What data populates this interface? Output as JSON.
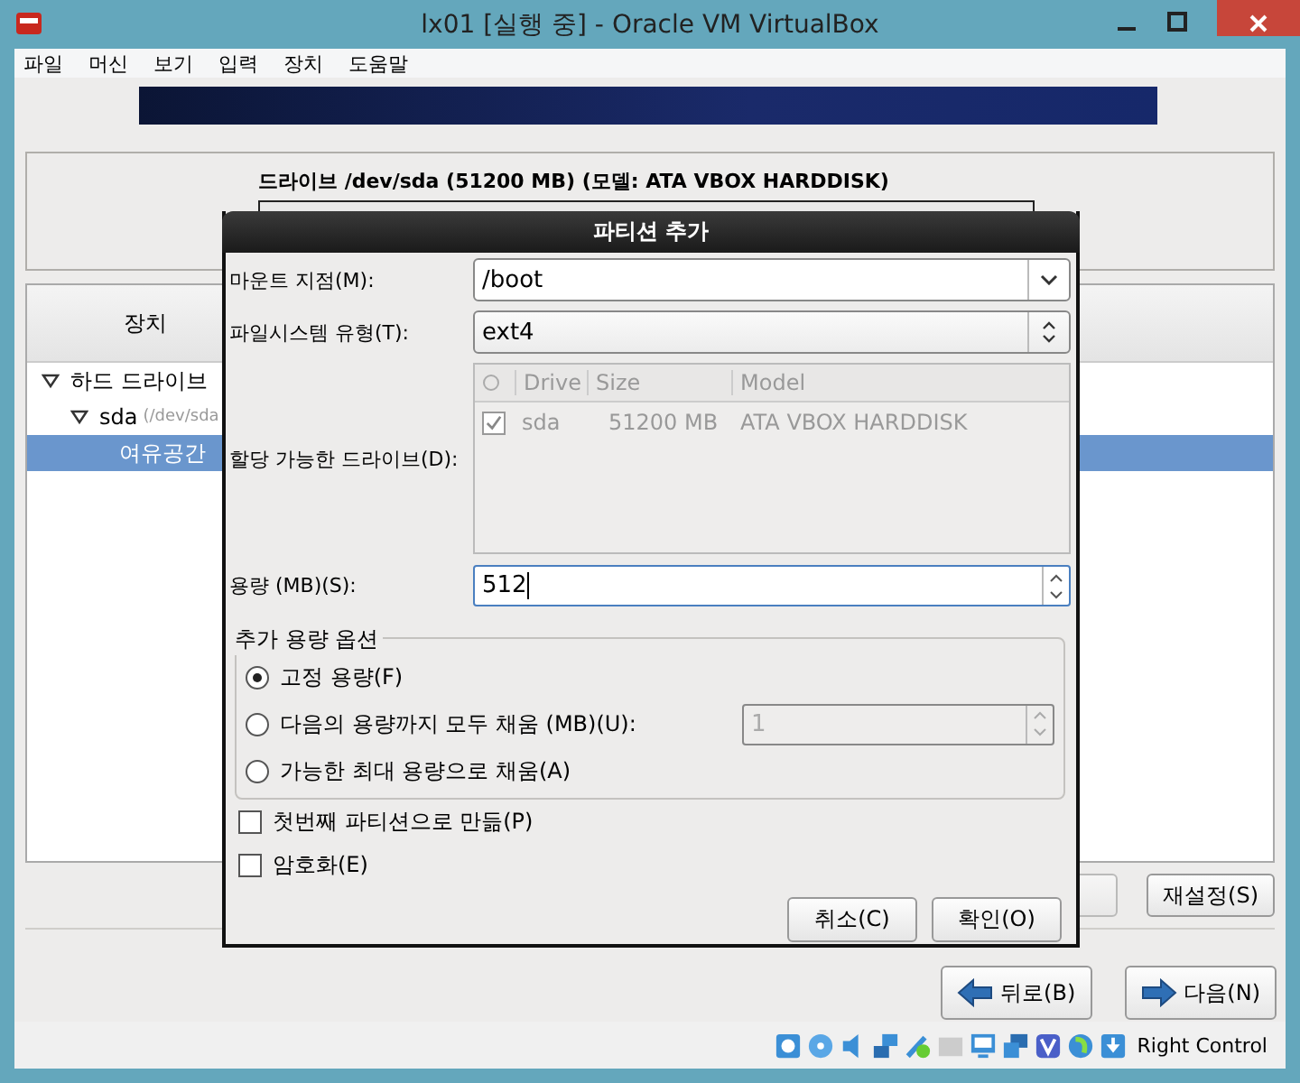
{
  "window": {
    "title": "lx01 [실행 중] - Oracle VM VirtualBox"
  },
  "menu": [
    "파일",
    "머신",
    "보기",
    "입력",
    "장치",
    "도움말"
  ],
  "drive_panel": {
    "heading": "드라이브 /dev/sda (51200 MB) (모델: ATA VBOX HARDDISK)"
  },
  "device_tree": {
    "column": "장치",
    "items": [
      {
        "label": "하드 드라이브",
        "expanded": true,
        "children": [
          {
            "label": "sda",
            "detail": "(/dev/sda",
            "expanded": true,
            "children": [
              {
                "label": "여유공간",
                "selected": true
              }
            ]
          }
        ]
      }
    ]
  },
  "reset_button": "재설정(S)",
  "nav_buttons": [
    {
      "label": "뒤로(B)",
      "kind": "back"
    },
    {
      "label": "다음(N)",
      "kind": "next"
    }
  ],
  "status_bar": {
    "host_key": "Right Control"
  },
  "dialog": {
    "title": "파티션 추가",
    "mount_point": {
      "label": "마운트 지점(M):",
      "value": "/boot"
    },
    "fs_type": {
      "label": "파일시스템 유형(T):",
      "value": "ext4"
    },
    "drives": {
      "label": "할당 가능한 드라이브(D):",
      "disabled": true,
      "columns": [
        "Drive",
        "Size",
        "Model"
      ],
      "rows": [
        {
          "drive": "sda",
          "size": "51200 MB",
          "model": "ATA VBOX HARDDISK",
          "checked": true
        }
      ]
    },
    "size": {
      "label": "용량 (MB)(S):",
      "value": "512"
    },
    "options": {
      "title": "추가 용량 옵션",
      "radios": [
        {
          "label": "고정 용량(F)",
          "selected": true,
          "kind": "plain"
        },
        {
          "label": "다음의 용량까지 모두 채움 (MB)(U):",
          "selected": false,
          "kind": "spin",
          "value": "1"
        },
        {
          "label": "가능한 최대 용량으로 채움(A)",
          "selected": false,
          "kind": "plain"
        }
      ]
    },
    "checks": [
      {
        "label": "첫번째 파티션으로 만듦(P)",
        "checked": false
      },
      {
        "label": "암호화(E)",
        "checked": false
      }
    ],
    "buttons": [
      "취소(C)",
      "확인(O)"
    ]
  }
}
